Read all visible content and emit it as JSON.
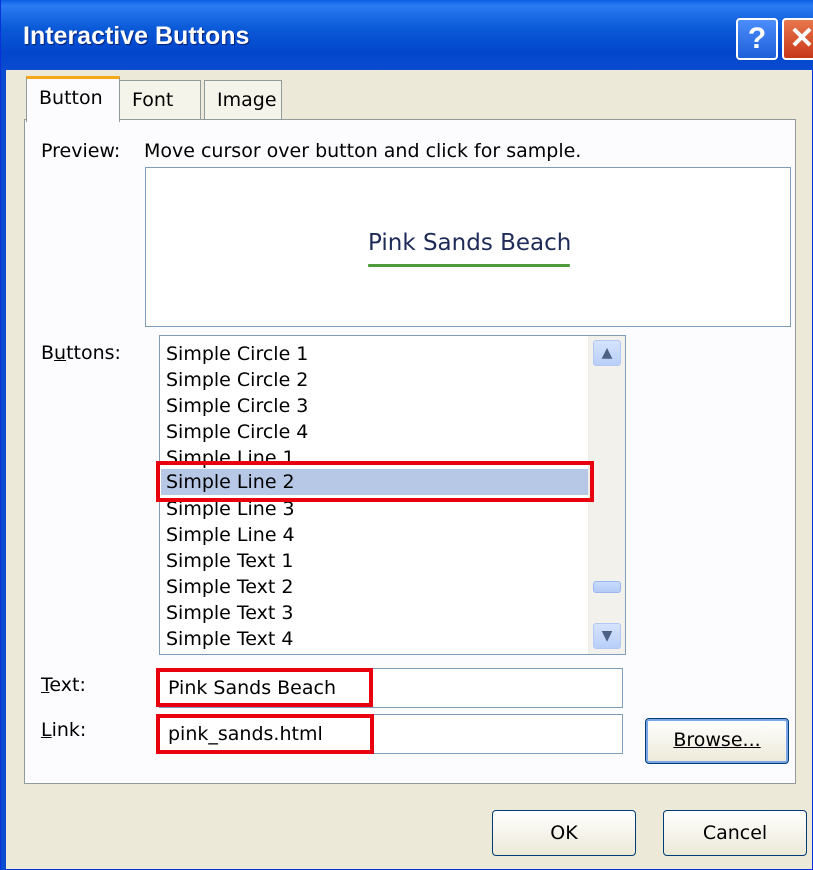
{
  "window": {
    "title": "Interactive Buttons",
    "help_glyph": "?",
    "close_glyph": "✕"
  },
  "tabs": [
    {
      "label": "Button",
      "active": true
    },
    {
      "label": "Font",
      "active": false
    },
    {
      "label": "Image",
      "active": false
    }
  ],
  "preview": {
    "label": "Preview:",
    "hint": "Move cursor over button and click for sample.",
    "sample_text": "Pink Sands Beach"
  },
  "buttons_list": {
    "label": "Buttons:",
    "items": [
      "Simple Circle 1",
      "Simple Circle 2",
      "Simple Circle 3",
      "Simple Circle 4",
      "Simple Line 1",
      "Simple Line 2",
      "Simple Line 3",
      "Simple Line 4",
      "Simple Text 1",
      "Simple Text 2",
      "Simple Text 3",
      "Simple Text 4"
    ],
    "selected": "Simple Line 2"
  },
  "text_field": {
    "label": "Text:",
    "value": "Pink Sands Beach"
  },
  "link_field": {
    "label": "Link:",
    "value": "pink_sands.html"
  },
  "actions": {
    "browse": "Browse...",
    "ok": "OK",
    "cancel": "Cancel"
  },
  "colors": {
    "titlebar": "#0a4bd0",
    "highlight_box": "#e8000f",
    "selection": "#b7c8e6",
    "tab_accent": "#f6a81b"
  }
}
